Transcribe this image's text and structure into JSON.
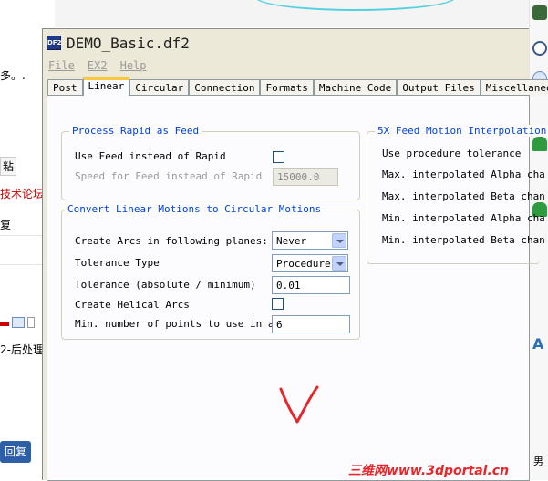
{
  "background": {
    "left_fragments": [
      "多。.",
      "粘",
      "技术论坛",
      "复",
      "2-后处理"
    ],
    "reply_button": "回复",
    "watermark": "三维网www.3dportal.cn",
    "right_text": "男"
  },
  "window": {
    "title": "DEMO_Basic.df2",
    "icon_label": "DF2",
    "menu": [
      "File",
      "EX2",
      "Help"
    ],
    "tabs": [
      "Post",
      "Linear",
      "Circular",
      "Connection",
      "Formats",
      "Machine Code",
      "Output Files",
      "Miscellaneous"
    ],
    "active_tab": "Linear"
  },
  "rapid_group": {
    "title": "Process Rapid as Feed",
    "use_feed_label": "Use Feed instead of Rapid",
    "use_feed_checked": false,
    "speed_label": "Speed for Feed instead of Rapid",
    "speed_value": "15000.0"
  },
  "circular_group": {
    "title": "Convert Linear Motions to Circular Motions",
    "create_arcs_label": "Create Arcs in following planes:",
    "create_arcs_value": "Never",
    "tolerance_type_label": "Tolerance Type",
    "tolerance_type_value": "Procedure",
    "tolerance_label": "Tolerance (absolute / minimum)",
    "tolerance_value": "0.01",
    "helical_label": "Create Helical Arcs",
    "helical_checked": false,
    "min_points_label": "Min. number of points to use in arc",
    "min_points_value": "6"
  },
  "fivex_group": {
    "title": "5X Feed Motion Interpolation",
    "lines": [
      "Use procedure tolerance",
      "Max. interpolated Alpha cha",
      "Max. interpolated Beta chan",
      "Min. interpolated Alpha cha",
      "Min. interpolated Beta chan"
    ]
  },
  "colors": {
    "group_title": "#0046d5",
    "active_tab_accent": "#ffc83c",
    "annotation": "#e8252a"
  }
}
